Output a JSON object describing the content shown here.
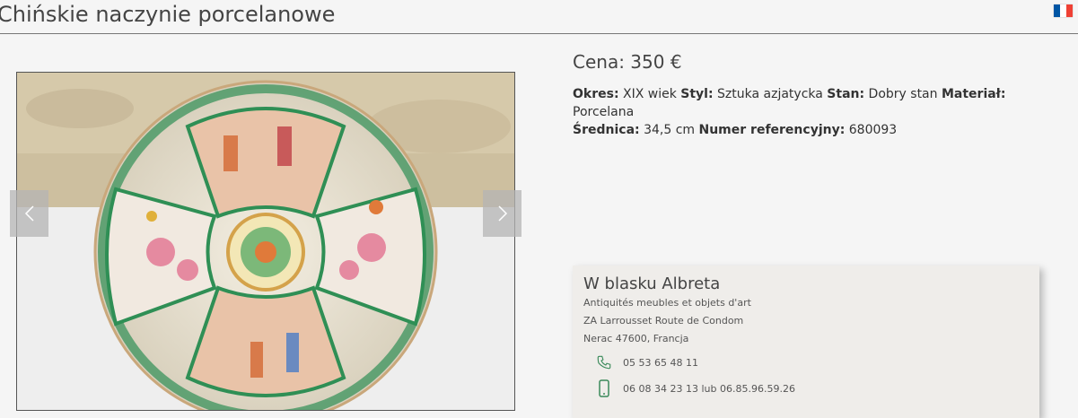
{
  "page": {
    "title": "Chińskie naczynie porcelanowe"
  },
  "language": {
    "flag": "flag-france-icon",
    "colors": [
      "#0055a4",
      "#ffffff",
      "#ef4135"
    ]
  },
  "gallery": {
    "prev_icon": "chevron-left-icon",
    "next_icon": "chevron-right-icon"
  },
  "product": {
    "price": "Cena: 350 €",
    "specs": [
      {
        "label": "Okres:",
        "value": "XIX wiek"
      },
      {
        "label": "Styl:",
        "value": "Sztuka azjatycka"
      },
      {
        "label": "Stan:",
        "value": "Dobry stan"
      },
      {
        "label": "Materiał:",
        "value": "Porcelana"
      },
      {
        "label": "Średnica:",
        "value": "34,5 cm"
      },
      {
        "label": "Numer referencyjny:",
        "value": "680093"
      }
    ]
  },
  "dealer": {
    "name": "W blasku Albreta",
    "tagline": "Antiquités meubles et objets d'art",
    "address1": "ZA Larrousset Route de Condom",
    "address2": "Nerac 47600, Francja",
    "phone": "05 53 65 48 11",
    "mobile": "06 08 34 23 13 lub 06.85.96.59.26",
    "accent": "#3a8a5a"
  }
}
